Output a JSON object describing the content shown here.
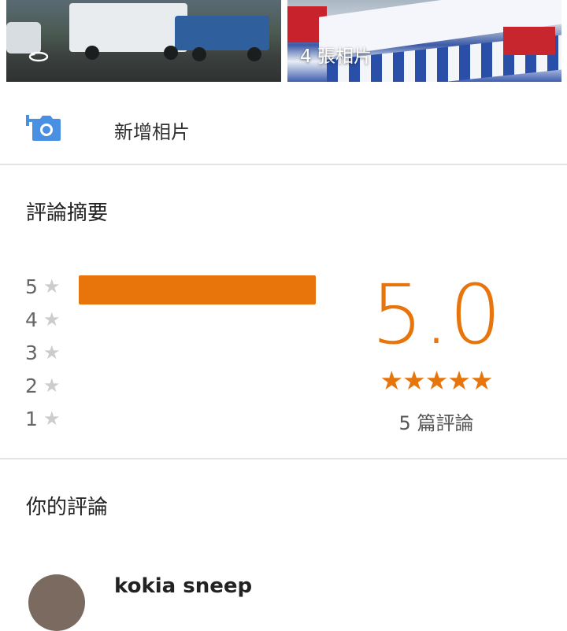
{
  "photos": {
    "count_label": "4 張相片"
  },
  "add_photo": {
    "label": "新增相片"
  },
  "summary": {
    "title": "評論摘要",
    "breakdown": [
      {
        "stars": "5",
        "fraction": 1.0
      },
      {
        "stars": "4",
        "fraction": 0
      },
      {
        "stars": "3",
        "fraction": 0
      },
      {
        "stars": "2",
        "fraction": 0
      },
      {
        "stars": "1",
        "fraction": 0
      }
    ],
    "average": "5.0",
    "stars_display": "★★★★★",
    "review_count": "5 篇評論"
  },
  "your_review": {
    "title": "你的評論",
    "name_partial": "kokia sneep"
  },
  "colors": {
    "accent": "#e8740c",
    "add_photo_icon": "#4a90e2"
  }
}
